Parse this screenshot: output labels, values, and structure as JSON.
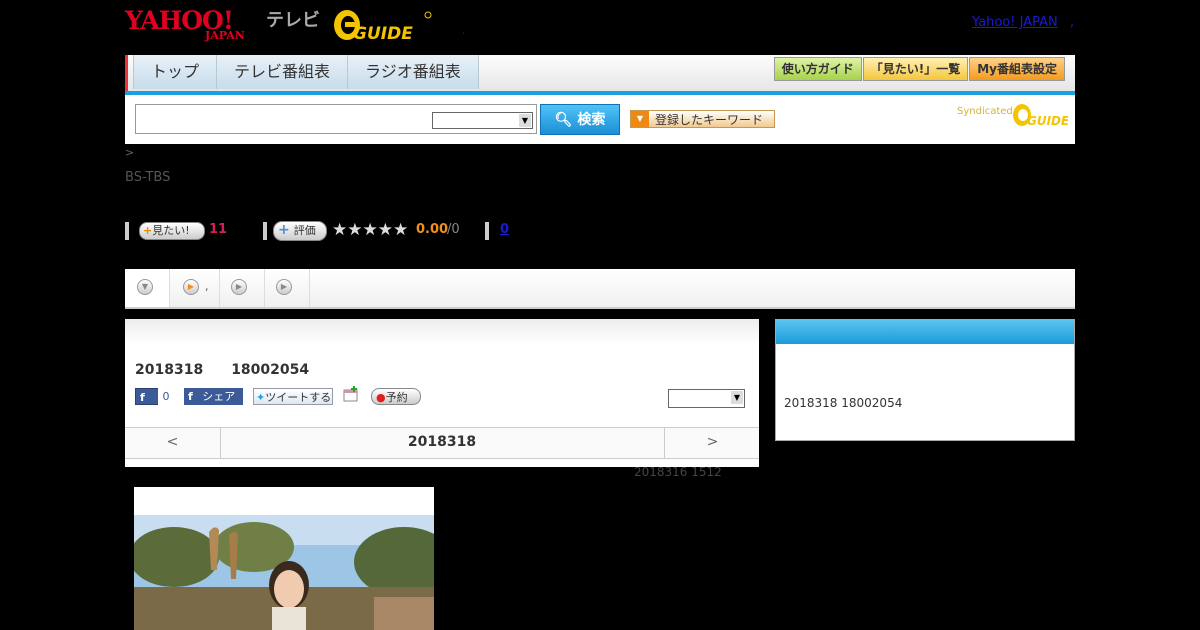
{
  "header": {
    "yahoo_logo_top": "YAHOO!",
    "yahoo_logo_bottom": "JAPAN",
    "tv_label": "テレビ",
    "gguide_logo": "GUIDE",
    "yahoo_japan_link": "Yahoo! JAPAN",
    "yahoo_japan_link_suffix": ","
  },
  "nav": {
    "tabs": [
      "トップ",
      "テレビ番組表",
      "ラジオ番組表"
    ],
    "buttons": [
      "使い方ガイド",
      "「見たい!」一覧",
      "My番組表設定"
    ]
  },
  "search": {
    "button_label": "検索",
    "keyword_button_label": "登録したキーワード",
    "syndicated_label": "Syndicated",
    "syndicated_logo": "GUIDE"
  },
  "breadcrumb": ">",
  "channel": "BS-TBS",
  "ratings": {
    "want_label": "見たい!",
    "want_count": "11",
    "rate_label": "評価",
    "stars": "★★★★★",
    "score": "0.00",
    "score_den": "/0",
    "comment_count": "0",
    "star_level": 0
  },
  "tabs": [
    {
      "label": ""
    },
    {
      "label": ","
    },
    {
      "label": ""
    },
    {
      "label": ""
    }
  ],
  "program": {
    "title": "2018318　　18002054",
    "fb_like_count": "0",
    "fb_share_label": "シェア",
    "tweet_label": "ツイートする",
    "reserve_label": "予約",
    "date_prev": "<",
    "date_current": "2018318",
    "date_next": ">",
    "updated": "2018316  1512"
  },
  "side": {
    "text": "2018318  18002054"
  },
  "colors": {
    "accent_blue": "#1aa0de",
    "yahoo_red": "#e1001f",
    "gguide_yellow": "#f5c400",
    "score_orange": "#ef8f1c",
    "want_pink": "#d02060"
  }
}
